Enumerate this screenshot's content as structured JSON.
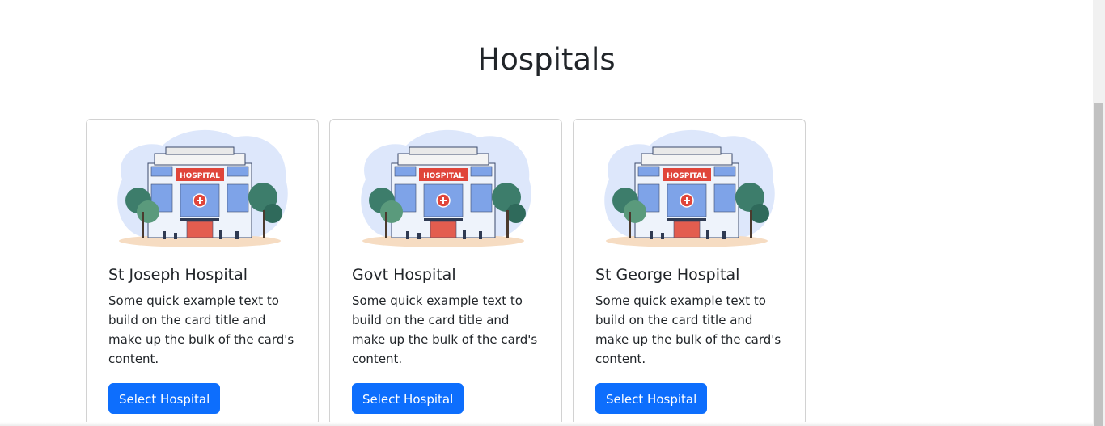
{
  "page": {
    "title": "Hospitals"
  },
  "cards": [
    {
      "image_name": "hospital-illustration",
      "image_sign": "HOSPITAL",
      "title": "St Joseph Hospital",
      "text": "Some quick example text to build on the card title and make up the bulk of the card's content.",
      "button_label": "Select Hospital"
    },
    {
      "image_name": "hospital-illustration",
      "image_sign": "HOSPITAL",
      "title": "Govt Hospital",
      "text": "Some quick example text to build on the card title and make up the bulk of the card's content.",
      "button_label": "Select Hospital"
    },
    {
      "image_name": "hospital-illustration",
      "image_sign": "HOSPITAL",
      "title": "St George Hospital",
      "text": "Some quick example text to build on the card title and make up the bulk of the card's content.",
      "button_label": "Select Hospital"
    }
  ],
  "colors": {
    "primary_button": "#0d6efd",
    "hospital_sign": "#e0453a",
    "building": "#7ea3e8"
  }
}
